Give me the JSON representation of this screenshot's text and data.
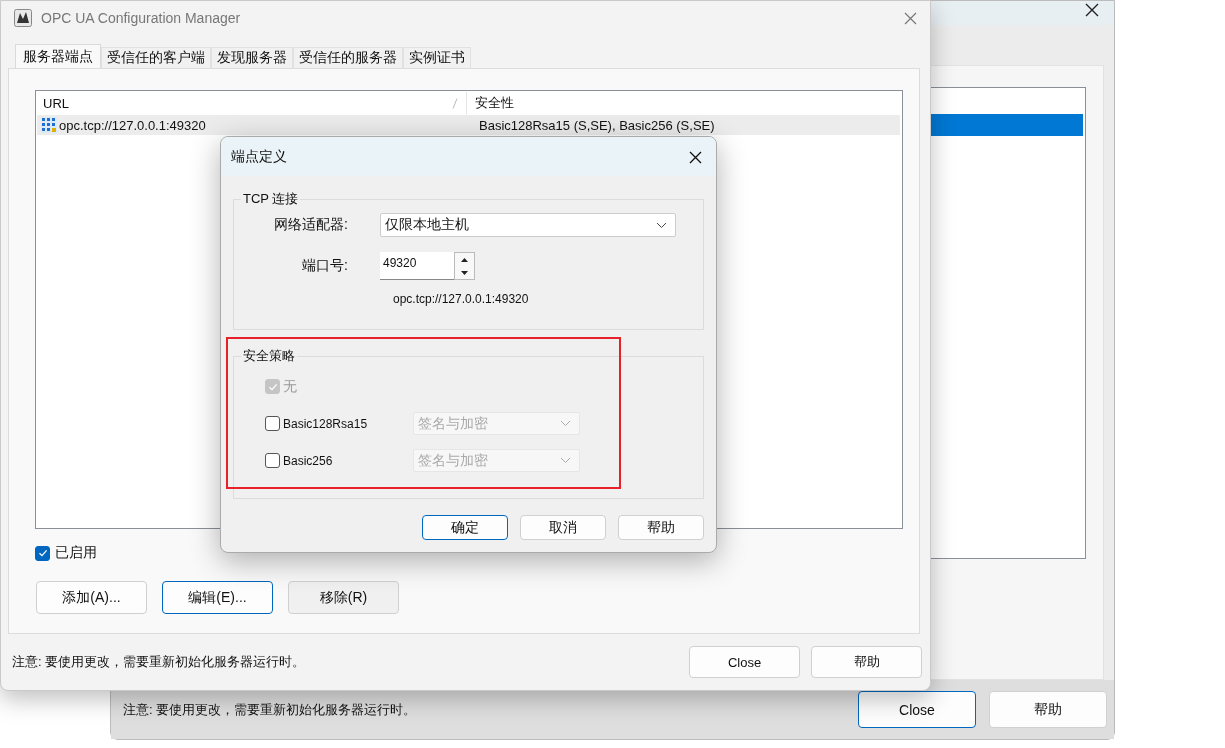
{
  "background_window": {
    "list": {
      "rows": [
        {
          "selected": true
        }
      ]
    },
    "note": "注意: 要使用更改，需要重新初始化服务器运行时。",
    "buttons": [
      {
        "label": "Close",
        "focused": true
      },
      {
        "label": "帮助",
        "focused": false
      }
    ]
  },
  "main_window": {
    "title": "OPC UA Configuration Manager",
    "tabs": [
      {
        "label": "服务器端点",
        "selected": true
      },
      {
        "label": "受信任的客户端",
        "selected": false
      },
      {
        "label": "发现服务器",
        "selected": false
      },
      {
        "label": "受信任的服务器",
        "selected": false
      },
      {
        "label": "实例证书",
        "selected": false
      }
    ],
    "list": {
      "columns": [
        "URL",
        "安全性"
      ],
      "rows": [
        {
          "url": "opc.tcp://127.0.0.1:49320",
          "security": "Basic128Rsa15 (S,SE), Basic256 (S,SE)",
          "selected": true
        }
      ]
    },
    "enabled": {
      "label": "已启用",
      "checked": true
    },
    "buttons": [
      {
        "label": "添加(A)...",
        "focused": false
      },
      {
        "label": "编辑(E)...",
        "focused": true
      },
      {
        "label": "移除(R)",
        "focused": false
      }
    ],
    "note": "注意: 要使用更改，需要重新初始化服务器运行时。",
    "footer_buttons": [
      {
        "label": "Close",
        "focused": false
      },
      {
        "label": "帮助",
        "focused": false
      }
    ]
  },
  "dialog": {
    "title": "端点定义",
    "tcp_group": {
      "legend": "TCP 连接",
      "adapter_label": "网络适配器:",
      "adapter_value": "仅限本地主机",
      "port_label": "端口号:",
      "port_value": "49320",
      "endpoint_url": "opc.tcp://127.0.0.1:49320"
    },
    "security_group": {
      "legend": "安全策略",
      "policies": [
        {
          "label": "无",
          "checked": true,
          "disabled": true
        },
        {
          "label": "Basic128Rsa15",
          "checked": false,
          "disabled": false,
          "mode": "签名与加密",
          "mode_disabled": true
        },
        {
          "label": "Basic256",
          "checked": false,
          "disabled": false,
          "mode": "签名与加密",
          "mode_disabled": true
        }
      ]
    },
    "buttons": [
      {
        "label": "确定",
        "focused": true
      },
      {
        "label": "取消",
        "focused": false
      },
      {
        "label": "帮助",
        "focused": false
      }
    ]
  }
}
